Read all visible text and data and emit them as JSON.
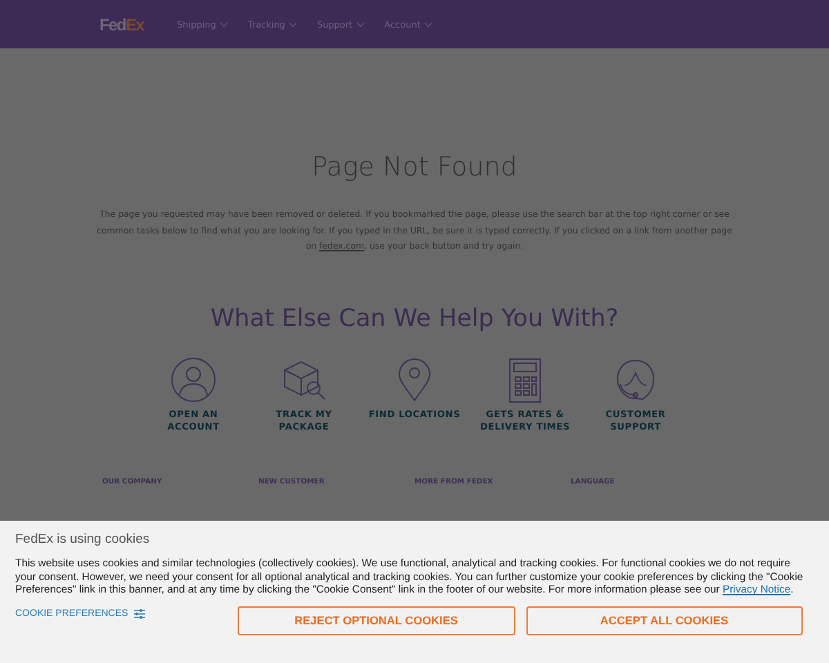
{
  "header": {
    "logo_main": "Fed",
    "logo_accent": "Ex",
    "nav": [
      {
        "label": "Shipping"
      },
      {
        "label": "Tracking"
      },
      {
        "label": "Support"
      },
      {
        "label": "Account"
      }
    ]
  },
  "main": {
    "title": "Page Not Found",
    "message_before": "The page you requested may have been removed or deleted. If you bookmarked the page, please use the search bar at the top right corner or see common tasks below to find what you are looking for. If you typed in the URL, be sure it is typed correctly. If you clicked on a link from another page on",
    "message_link": "fedex.com",
    "message_after": ", use your back button and try again.",
    "help_title": "What Else Can We Help You With?",
    "tasks": [
      {
        "label": "OPEN AN ACCOUNT"
      },
      {
        "label": "TRACK MY PACKAGE"
      },
      {
        "label": "FIND LOCATIONS"
      },
      {
        "label": "GETS RATES & DELIVERY TIMES"
      },
      {
        "label": "CUSTOMER SUPPORT"
      }
    ]
  },
  "footer": {
    "headings": [
      "OUR COMPANY",
      "NEW CUSTOMER",
      "MORE FROM FEDEX",
      "LANGUAGE"
    ]
  },
  "cookie_banner": {
    "title": "FedEx is using cookies",
    "text": "This website uses cookies and similar technologies (collectively cookies). We use functional, analytical and tracking cookies. For functional cookies we do not require your consent. However, we need your consent for all optional analytical and tracking cookies. You can further customize your cookie preferences by clicking the \"Cookie Preferences\" link in this banner, and at any time by clicking the \"Cookie Consent\" link in the footer of our website. For more information please see our",
    "link": "Privacy Notice",
    "text_end": ".",
    "preferences": "COOKIE PREFERENCES",
    "buttons": [
      "REJECT OPTIONAL COOKIES",
      "ACCEPT ALL COOKIES"
    ]
  }
}
